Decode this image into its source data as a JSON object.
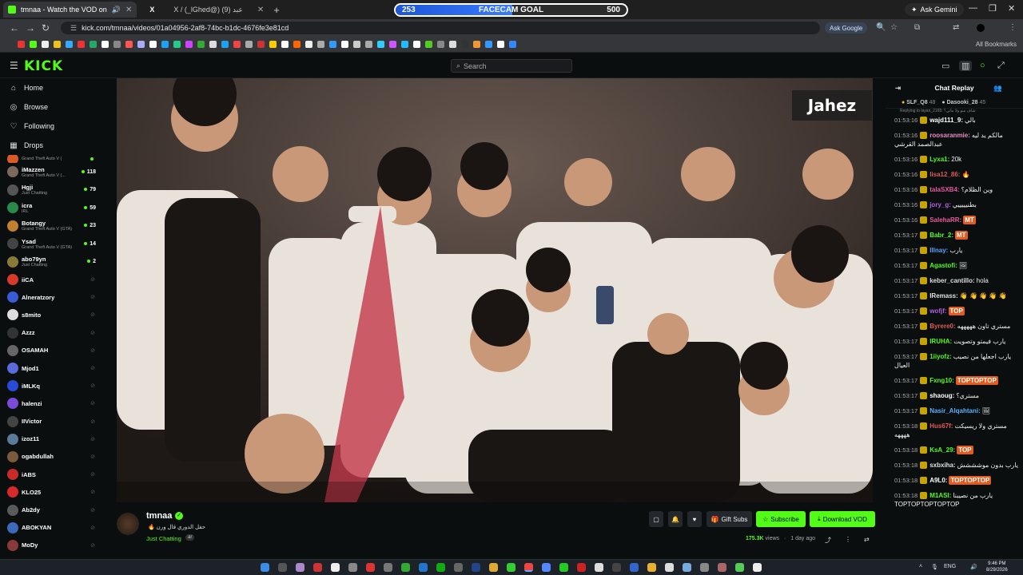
{
  "browser": {
    "tabs": [
      {
        "title": "tmnaa - Watch the VOD on",
        "active": true
      },
      {
        "title": "X / (_lGhed@) عبد (9)",
        "active": false
      }
    ],
    "new_tab": "+",
    "goal": {
      "current": "253",
      "label": "FACECAM GOAL",
      "target": "500",
      "progress": 0.506
    },
    "gemini": "Ask Gemini",
    "url": "kick.com/tmnaa/videos/01a04956-2af8-74bc-b1dc-4676fe3e81cd",
    "ask_google": "Ask Google",
    "all_bookmarks": "All Bookmarks"
  },
  "kick": {
    "logo": "KICK",
    "search_placeholder": "Search"
  },
  "sidebar": {
    "nav": [
      {
        "label": "Home",
        "icon": "home-icon"
      },
      {
        "label": "Browse",
        "icon": "compass-icon"
      },
      {
        "label": "Following",
        "icon": "heart-icon"
      },
      {
        "label": "Drops",
        "icon": "drops-icon"
      }
    ],
    "live_channels": [
      {
        "name": "",
        "sub": "Grand Theft Auto V (",
        "count": "",
        "color": "#d85a2a"
      },
      {
        "name": "iMazzen",
        "sub": "Grand Theft Auto V (...",
        "count": "118",
        "color": "#7a6a5a"
      },
      {
        "name": "Hgji",
        "sub": "Just Chatting",
        "count": "79",
        "color": "#555"
      },
      {
        "name": "icra",
        "sub": "IRL",
        "count": "59",
        "color": "#2a8a4a"
      },
      {
        "name": "Botangy",
        "sub": "Grand Theft Auto V (GTA)",
        "count": "23",
        "color": "#c08030"
      },
      {
        "name": "Ysad",
        "sub": "Grand Theft Auto V (GTA)",
        "count": "14",
        "color": "#444"
      },
      {
        "name": "abo79yn",
        "sub": "Just Chatting",
        "count": "2",
        "color": "#8a7a3a"
      }
    ],
    "offline_channels": [
      {
        "name": "iiCA",
        "color": "#d83a2a"
      },
      {
        "name": "Alneratzory",
        "color": "#3a5ad8"
      },
      {
        "name": "s8mito",
        "color": "#ddd"
      },
      {
        "name": "Azzz",
        "color": "#333"
      },
      {
        "name": "OSAMAH",
        "color": "#666"
      },
      {
        "name": "Mjod1",
        "color": "#5a6ad8"
      },
      {
        "name": "iMLKq",
        "color": "#2a4ad8"
      },
      {
        "name": "halenzi",
        "color": "#7a4ad8"
      },
      {
        "name": "IIVictor",
        "color": "#444"
      },
      {
        "name": "izoz11",
        "color": "#5a7a9a"
      },
      {
        "name": "ogabdullah",
        "color": "#7a5a3a"
      },
      {
        "name": "iABS",
        "color": "#c82a2a"
      },
      {
        "name": "KLO25",
        "color": "#d82a2a"
      },
      {
        "name": "Ab2dy",
        "color": "#5a5a5a"
      },
      {
        "name": "ABOKYAN",
        "color": "#3a6ab8"
      },
      {
        "name": "MoDy",
        "color": "#8a3a3a"
      }
    ]
  },
  "video": {
    "overlay_logo": "Jahez"
  },
  "stream": {
    "streamer": "tmnaa",
    "title": "🔥 حفل الدوري قال ورن",
    "category": "Just Chatting",
    "language": "ar",
    "views": "175.3K",
    "views_label": "views",
    "age": "1 day ago",
    "gift_subs": "Gift Subs",
    "subscribe": "Subscribe",
    "download": "Download VOD"
  },
  "chat": {
    "title": "Chat Replay",
    "pinned": [
      {
        "name": "SLF_Q8",
        "count": "48"
      },
      {
        "name": "Dasooki_28",
        "count": "45"
      }
    ],
    "reply_to": "Replying to layan_2165: شاف منو ولا ماتي؟",
    "messages": [
      {
        "time": "01:53:16",
        "user": "wajd111_9:",
        "color": "#ffffff",
        "text": "بالي"
      },
      {
        "time": "01:53:16",
        "user": "roosaranmie:",
        "color": "#e58cc0",
        "text": "مالكم يد ليه عبدالصمد القرشي"
      },
      {
        "time": "01:53:16",
        "user": "Lyxa1:",
        "color": "#53fc18",
        "text": "20k"
      },
      {
        "time": "01:53:16",
        "user": "lisa12_86:",
        "color": "#e05a5a",
        "text": "🔥"
      },
      {
        "time": "01:53:16",
        "user": "talaSXB4:",
        "color": "#e058a0",
        "text": "وين الظلام؟"
      },
      {
        "time": "01:53:16",
        "user": "jory_g:",
        "color": "#b060e0",
        "text": "بطنيييييي"
      },
      {
        "time": "01:53:16",
        "user": "SalehaRR:",
        "color": "#e85a9a",
        "text": "MT"
      },
      {
        "time": "01:53:17",
        "user": "Babr_2:",
        "color": "#53fc18",
        "text": "MT"
      },
      {
        "time": "01:53:17",
        "user": "lllnay:",
        "color": "#5aa0ff",
        "text": "يارب"
      },
      {
        "time": "01:53:17",
        "user": "Agastofi:",
        "color": "#53fc18",
        "text": "🖼"
      },
      {
        "time": "01:53:17",
        "user": "keber_cantillo:",
        "color": "#dddddd",
        "text": "hola"
      },
      {
        "time": "01:53:17",
        "user": "IRemass:",
        "color": "#e0e0e0",
        "text": "👋 👋 👋 👋 👋"
      },
      {
        "time": "01:53:17",
        "user": "wofjf:",
        "color": "#b060e0",
        "text": "TOP"
      },
      {
        "time": "01:53:17",
        "user": "Byrere0:",
        "color": "#e05a5a",
        "text": "مستري تاون هههههه"
      },
      {
        "time": "01:53:17",
        "user": "IRUHA:",
        "color": "#53fc18",
        "text": "يارب فيمتو وتصويت"
      },
      {
        "time": "01:53:17",
        "user": "1iiyofz:",
        "color": "#53fc18",
        "text": "يارب اجعلها من نصيب العيال"
      },
      {
        "time": "01:53:17",
        "user": "Fxng10:",
        "color": "#53fc18",
        "text": "TOPTOPTOP"
      },
      {
        "time": "01:53:17",
        "user": "shaoug:",
        "color": "#ffffff",
        "text": "مستري؟"
      },
      {
        "time": "01:53:17",
        "user": "Nasir_Alqahtani:",
        "color": "#5ab0ff",
        "text": "🖼"
      },
      {
        "time": "01:53:18",
        "user": "Hus67f:",
        "color": "#e05a5a",
        "text": "مستري ولا ريسيكت ههههه"
      },
      {
        "time": "01:53:18",
        "user": "KsA_29:",
        "color": "#53fc18",
        "text": "TOP"
      },
      {
        "time": "01:53:18",
        "user": "sxbxiha:",
        "color": "#e0e0e0",
        "text": "يارب بدون موشششش"
      },
      {
        "time": "01:53:18",
        "user": "A9L0:",
        "color": "#ffffff",
        "text": "TOPTOPTOP"
      },
      {
        "time": "01:53:18",
        "user": "M1ASI:",
        "color": "#53fc18",
        "text": "يارب من نصيبنا TOPTOPTOPTOPTOP"
      }
    ]
  },
  "taskbar": {
    "time": "9:46 PM",
    "date": "8/29/2026",
    "lang": "ENG"
  }
}
